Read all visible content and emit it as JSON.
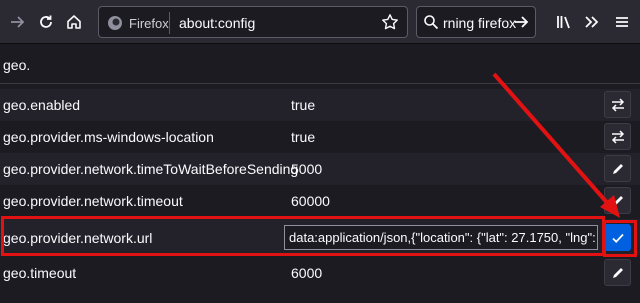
{
  "toolbar": {
    "back_icon": "back-arrow-icon",
    "forward_icon": "forward-arrow-icon",
    "reload_icon": "reload-icon",
    "home_icon": "home-icon",
    "identity_label": "Firefox",
    "url": "about:config",
    "search_text": "rning firefox",
    "library_icon": "library-icon",
    "overflow_icon": "chevron-double-right-icon",
    "menu_icon": "hamburger-menu-icon"
  },
  "filter": {
    "value": "geo."
  },
  "prefs": [
    {
      "name": "geo.enabled",
      "value": "true",
      "action": "toggle-icon"
    },
    {
      "name": "geo.provider.ms-windows-location",
      "value": "true",
      "action": "toggle-icon"
    },
    {
      "name": "geo.provider.network.timeToWaitBeforeSending",
      "value": "5000",
      "action": "pencil-icon"
    },
    {
      "name": "geo.provider.network.timeout",
      "value": "60000",
      "action": "pencil-icon"
    },
    {
      "name": "geo.provider.network.url",
      "value": "data:application/json,{\"location\": {\"lat\": 27.1750, \"lng\":",
      "action": "checkmark-icon",
      "editing": true
    },
    {
      "name": "geo.timeout",
      "value": "6000",
      "action": "pencil-icon"
    }
  ],
  "colors": {
    "background": "#1c1b22",
    "accent": "#0060df",
    "annotation": "#e31212"
  }
}
